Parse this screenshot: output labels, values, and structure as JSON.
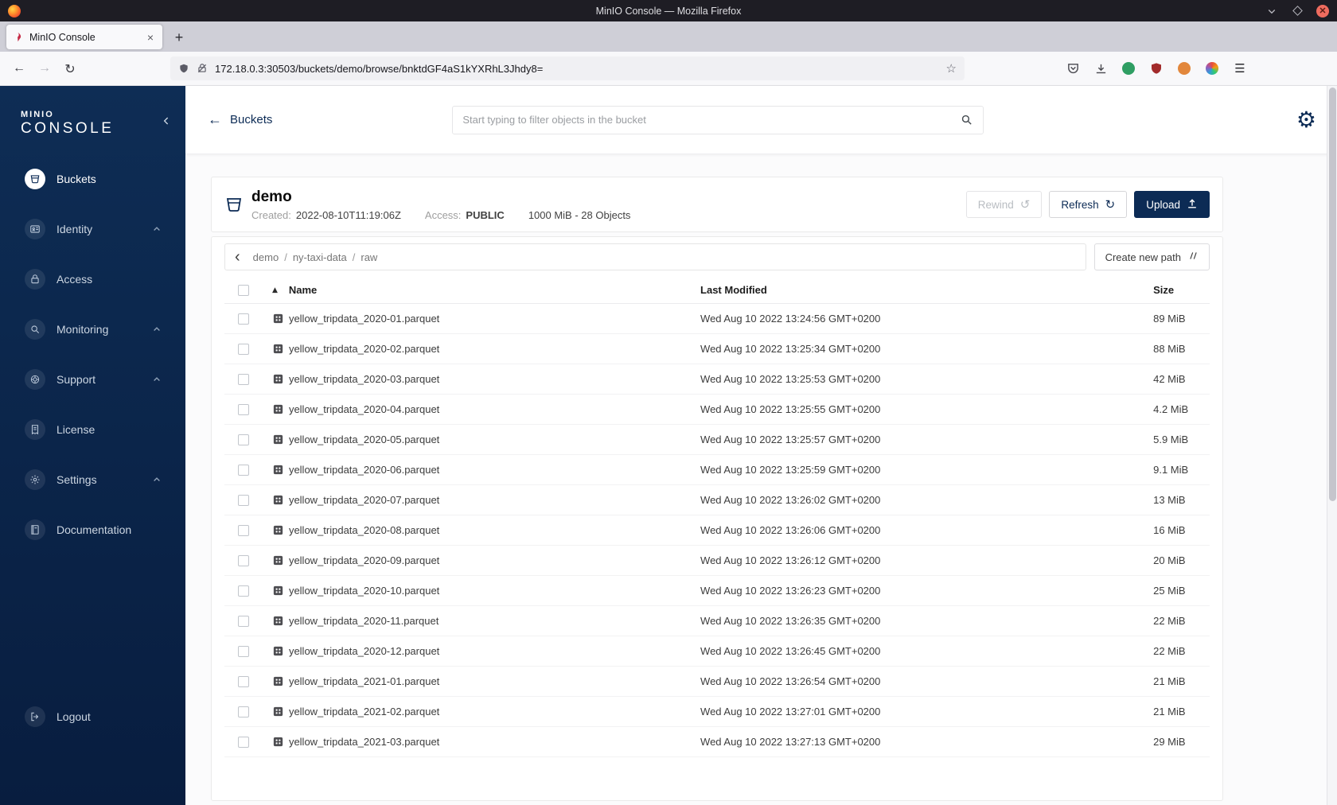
{
  "window": {
    "title": "MinIO Console — Mozilla Firefox",
    "tab_title": "MinIO Console",
    "new_tab_label": "+",
    "url": "172.18.0.3:30503/buckets/demo/browse/bnktdGF4aS1kYXRhL3Jhdy8=",
    "controls": [
      "minimize",
      "maximize",
      "close"
    ],
    "toolbar_icons": [
      "back-icon",
      "forward-icon",
      "reload-icon",
      "shield-permissions-icon",
      "lock-insecure-icon",
      "bookmark-star-icon",
      "pocket-icon",
      "downloads-icon",
      "extension-green-icon",
      "ublock-shield-icon",
      "extension-orange-icon",
      "extension-pinwheel-icon",
      "menu-icon"
    ]
  },
  "sidebar": {
    "logo": {
      "line1": "MINIO",
      "line2": "CONSOLE"
    },
    "items": [
      {
        "label": "Buckets",
        "icon": "bucket",
        "active": true,
        "expandable": false
      },
      {
        "label": "Identity",
        "icon": "identity",
        "active": false,
        "expandable": true
      },
      {
        "label": "Access",
        "icon": "access",
        "active": false,
        "expandable": false
      },
      {
        "label": "Monitoring",
        "icon": "monitoring",
        "active": false,
        "expandable": true
      },
      {
        "label": "Support",
        "icon": "support",
        "active": false,
        "expandable": true
      },
      {
        "label": "License",
        "icon": "license",
        "active": false,
        "expandable": false
      },
      {
        "label": "Settings",
        "icon": "settings",
        "active": false,
        "expandable": true
      },
      {
        "label": "Documentation",
        "icon": "documentation",
        "active": false,
        "expandable": false
      }
    ],
    "logout_label": "Logout"
  },
  "header": {
    "back_label": "Buckets",
    "search_placeholder": "Start typing to filter objects in the bucket"
  },
  "bucket": {
    "name": "demo",
    "created_label": "Created:",
    "created_value": "2022-08-10T11:19:06Z",
    "access_label": "Access:",
    "access_value": "PUBLIC",
    "usage": "1000 MiB - 28 Objects",
    "rewind_label": "Rewind",
    "refresh_label": "Refresh",
    "upload_label": "Upload"
  },
  "path_bar": {
    "segments": [
      "demo",
      "ny-taxi-data",
      "raw"
    ],
    "create_path_label": "Create new path"
  },
  "objects_table": {
    "columns": {
      "name": "Name",
      "last_modified": "Last Modified",
      "size": "Size"
    },
    "sort": {
      "column": "Name",
      "direction": "asc"
    },
    "rows": [
      {
        "name": "yellow_tripdata_2020-01.parquet",
        "last_modified": "Wed Aug 10 2022 13:24:56 GMT+0200",
        "size": "89 MiB"
      },
      {
        "name": "yellow_tripdata_2020-02.parquet",
        "last_modified": "Wed Aug 10 2022 13:25:34 GMT+0200",
        "size": "88 MiB"
      },
      {
        "name": "yellow_tripdata_2020-03.parquet",
        "last_modified": "Wed Aug 10 2022 13:25:53 GMT+0200",
        "size": "42 MiB"
      },
      {
        "name": "yellow_tripdata_2020-04.parquet",
        "last_modified": "Wed Aug 10 2022 13:25:55 GMT+0200",
        "size": "4.2 MiB"
      },
      {
        "name": "yellow_tripdata_2020-05.parquet",
        "last_modified": "Wed Aug 10 2022 13:25:57 GMT+0200",
        "size": "5.9 MiB"
      },
      {
        "name": "yellow_tripdata_2020-06.parquet",
        "last_modified": "Wed Aug 10 2022 13:25:59 GMT+0200",
        "size": "9.1 MiB"
      },
      {
        "name": "yellow_tripdata_2020-07.parquet",
        "last_modified": "Wed Aug 10 2022 13:26:02 GMT+0200",
        "size": "13 MiB"
      },
      {
        "name": "yellow_tripdata_2020-08.parquet",
        "last_modified": "Wed Aug 10 2022 13:26:06 GMT+0200",
        "size": "16 MiB"
      },
      {
        "name": "yellow_tripdata_2020-09.parquet",
        "last_modified": "Wed Aug 10 2022 13:26:12 GMT+0200",
        "size": "20 MiB"
      },
      {
        "name": "yellow_tripdata_2020-10.parquet",
        "last_modified": "Wed Aug 10 2022 13:26:23 GMT+0200",
        "size": "25 MiB"
      },
      {
        "name": "yellow_tripdata_2020-11.parquet",
        "last_modified": "Wed Aug 10 2022 13:26:35 GMT+0200",
        "size": "22 MiB"
      },
      {
        "name": "yellow_tripdata_2020-12.parquet",
        "last_modified": "Wed Aug 10 2022 13:26:45 GMT+0200",
        "size": "22 MiB"
      },
      {
        "name": "yellow_tripdata_2021-01.parquet",
        "last_modified": "Wed Aug 10 2022 13:26:54 GMT+0200",
        "size": "21 MiB"
      },
      {
        "name": "yellow_tripdata_2021-02.parquet",
        "last_modified": "Wed Aug 10 2022 13:27:01 GMT+0200",
        "size": "21 MiB"
      },
      {
        "name": "yellow_tripdata_2021-03.parquet",
        "last_modified": "Wed Aug 10 2022 13:27:13 GMT+0200",
        "size": "29 MiB"
      }
    ]
  },
  "colors": {
    "primary_navy": "#0c2b55",
    "sidebar_top": "#0e2d55",
    "sidebar_bottom": "#081d3f",
    "access_public_badge": "#414141",
    "minio_brand_red": "#c72c48"
  },
  "icon_glyphs": {
    "gear": "⚙",
    "refresh": "↻",
    "rewind": "↺",
    "sort_asc": "▲",
    "back_arrow": "←",
    "star": "☆",
    "menu": "☰"
  }
}
